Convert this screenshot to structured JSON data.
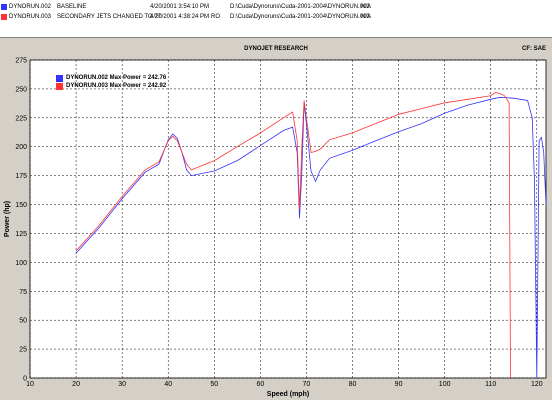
{
  "runs": [
    {
      "file": "DYNORUN.002",
      "description": "BASELINE",
      "date": "4/20/2001 3:54:10 PM",
      "flag": "",
      "path": "D:\\Cuda\\Dynoruns\\Cuda-2001-2004\\DYNORUN.002",
      "na": "N/A",
      "color": "#3333ff"
    },
    {
      "file": "DYNORUN.003",
      "description": "SECONDARY JETS CHANGED TO 77",
      "date": "4/20/2001 4:38:24 PM",
      "flag": "RO",
      "path": "D:\\Cuda\\Dynoruns\\Cuda-2001-2004\\DYNORUN.003",
      "na": "N/A",
      "color": "#ff3333"
    }
  ],
  "header": {
    "title": "DYNOJET RESEARCH",
    "cf": "CF: SAE"
  },
  "legend": [
    {
      "label": "DYNORUN.002 Max Power = 242.76",
      "color": "#3333ff"
    },
    {
      "label": "DYNORUN.003 Max Power = 242.92",
      "color": "#ff3333"
    }
  ],
  "chart_data": {
    "type": "line",
    "title": "DYNOJET RESEARCH",
    "xlabel": "Speed (mph)",
    "ylabel": "Power (hp)",
    "xlim": [
      10,
      122
    ],
    "ylim": [
      0,
      275
    ],
    "xticks": [
      10,
      20,
      30,
      40,
      50,
      60,
      70,
      80,
      90,
      100,
      110,
      120
    ],
    "yticks": [
      0,
      25,
      50,
      75,
      100,
      125,
      150,
      175,
      200,
      225,
      250,
      275
    ],
    "grid": true,
    "legend_position": "top-left",
    "series": [
      {
        "name": "DYNORUN.002",
        "color": "#3333ff",
        "points": [
          [
            20,
            108
          ],
          [
            25,
            130
          ],
          [
            30,
            155
          ],
          [
            35,
            178
          ],
          [
            38,
            185
          ],
          [
            40,
            206
          ],
          [
            41,
            211
          ],
          [
            42,
            207
          ],
          [
            43,
            195
          ],
          [
            44,
            180
          ],
          [
            45,
            175
          ],
          [
            50,
            179
          ],
          [
            55,
            188
          ],
          [
            60,
            201
          ],
          [
            65,
            214
          ],
          [
            67,
            217
          ],
          [
            68,
            195
          ],
          [
            68.5,
            138
          ],
          [
            69,
            178
          ],
          [
            69.5,
            238
          ],
          [
            70,
            220
          ],
          [
            71,
            179
          ],
          [
            72,
            170
          ],
          [
            73,
            180
          ],
          [
            75,
            190
          ],
          [
            80,
            197
          ],
          [
            85,
            205
          ],
          [
            90,
            213
          ],
          [
            95,
            220
          ],
          [
            100,
            229
          ],
          [
            105,
            236
          ],
          [
            110,
            241
          ],
          [
            112,
            242.76
          ],
          [
            115,
            242
          ],
          [
            118,
            240
          ],
          [
            119,
            225
          ],
          [
            119.5,
            170
          ],
          [
            120,
            0
          ],
          [
            120.5,
            205
          ],
          [
            121,
            208
          ],
          [
            121.5,
            195
          ],
          [
            122,
            150
          ]
        ]
      },
      {
        "name": "DYNORUN.003",
        "color": "#ff3333",
        "points": [
          [
            20,
            110
          ],
          [
            25,
            132
          ],
          [
            30,
            157
          ],
          [
            35,
            180
          ],
          [
            38,
            187
          ],
          [
            40,
            205
          ],
          [
            41,
            209
          ],
          [
            42,
            205
          ],
          [
            43,
            195
          ],
          [
            44,
            185
          ],
          [
            45,
            180
          ],
          [
            50,
            188
          ],
          [
            55,
            200
          ],
          [
            60,
            212
          ],
          [
            65,
            225
          ],
          [
            67,
            230
          ],
          [
            68,
            205
          ],
          [
            68.5,
            145
          ],
          [
            69,
            200
          ],
          [
            69.5,
            240
          ],
          [
            70,
            225
          ],
          [
            71,
            195
          ],
          [
            72,
            196
          ],
          [
            73,
            198
          ],
          [
            75,
            206
          ],
          [
            80,
            212
          ],
          [
            85,
            220
          ],
          [
            90,
            228
          ],
          [
            95,
            233
          ],
          [
            100,
            238
          ],
          [
            105,
            241
          ],
          [
            110,
            244
          ],
          [
            111,
            247
          ],
          [
            112,
            246
          ],
          [
            113,
            244
          ],
          [
            114,
            238
          ],
          [
            114.3,
            0
          ]
        ]
      }
    ]
  }
}
